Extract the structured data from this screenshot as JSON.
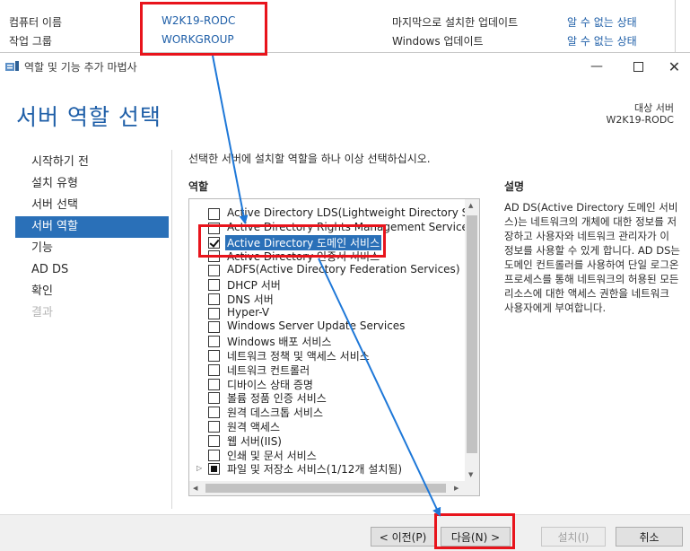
{
  "server_info": {
    "computer_name_label": "컴퓨터 이름",
    "computer_name_value": "W2K19-RODC",
    "workgroup_label": "작업 그룹",
    "workgroup_value": "WORKGROUP",
    "last_update_label": "마지막으로 설치한 업데이트",
    "last_update_value": "알 수 없는 상태",
    "windows_update_label": "Windows 업데이트",
    "windows_update_value": "알 수 없는 상태"
  },
  "dialog": {
    "title": "역할 및 기능 추가 마법사",
    "header": "서버 역할 선택",
    "dest_label": "대상 서버",
    "dest_server": "W2K19-RODC",
    "instruction": "선택한 서버에 설치할 역할을 하나 이상 선택하십시오.",
    "roles_heading": "역할",
    "desc_heading": "설명",
    "description": "AD DS(Active Directory 도메인 서비스)는 네트워크의 개체에 대한 정보를 저장하고 사용자와 네트워크 관리자가 이 정보를 사용할 수 있게 합니다. AD DS는 도메인 컨트롤러를 사용하여 단일 로그온 프로세스를 통해 네트워크의 허용된 모든 리소스에 대한 액세스 권한을 네트워크 사용자에게 부여합니다."
  },
  "nav": [
    {
      "label": "시작하기 전",
      "state": "normal"
    },
    {
      "label": "설치 유형",
      "state": "normal"
    },
    {
      "label": "서버 선택",
      "state": "normal"
    },
    {
      "label": "서버 역할",
      "state": "active"
    },
    {
      "label": "기능",
      "state": "normal"
    },
    {
      "label": "AD DS",
      "state": "normal"
    },
    {
      "label": "확인",
      "state": "normal"
    },
    {
      "label": "결과",
      "state": "disabled"
    }
  ],
  "roles": [
    {
      "label": "Active Directory LDS(Lightweight Directory Servic",
      "checked": false
    },
    {
      "label": "Active Directory Rights Management Services",
      "checked": false
    },
    {
      "label": "Active Directory 도메인 서비스",
      "checked": true,
      "selected": true
    },
    {
      "label": "Active Directory 인증서 서비스",
      "checked": false
    },
    {
      "label": "ADFS(Active Directory Federation Services)",
      "checked": false
    },
    {
      "label": "DHCP 서버",
      "checked": false
    },
    {
      "label": "DNS 서버",
      "checked": false
    },
    {
      "label": "Hyper-V",
      "checked": false
    },
    {
      "label": "Windows Server Update Services",
      "checked": false
    },
    {
      "label": "Windows 배포 서비스",
      "checked": false
    },
    {
      "label": "네트워크 정책 및 액세스 서비스",
      "checked": false
    },
    {
      "label": "네트워크 컨트롤러",
      "checked": false
    },
    {
      "label": "디바이스 상태 증명",
      "checked": false
    },
    {
      "label": "볼륨 정품 인증 서비스",
      "checked": false
    },
    {
      "label": "원격 데스크톱 서비스",
      "checked": false
    },
    {
      "label": "원격 액세스",
      "checked": false
    },
    {
      "label": "웹 서버(IIS)",
      "checked": false
    },
    {
      "label": "인쇄 및 문서 서비스",
      "checked": false
    },
    {
      "label": "파일 및 저장소 서비스(1/12개 설치됨)",
      "checked": "partial",
      "expandable": true
    }
  ],
  "footer": {
    "prev": "< 이전(P)",
    "next": "다음(N) >",
    "install": "설치(I)",
    "cancel": "취소"
  },
  "colors": {
    "accent": "#2a70b8",
    "link": "#1f5fa8",
    "highlight": "#e8141c",
    "arrow": "#1e78d8"
  }
}
